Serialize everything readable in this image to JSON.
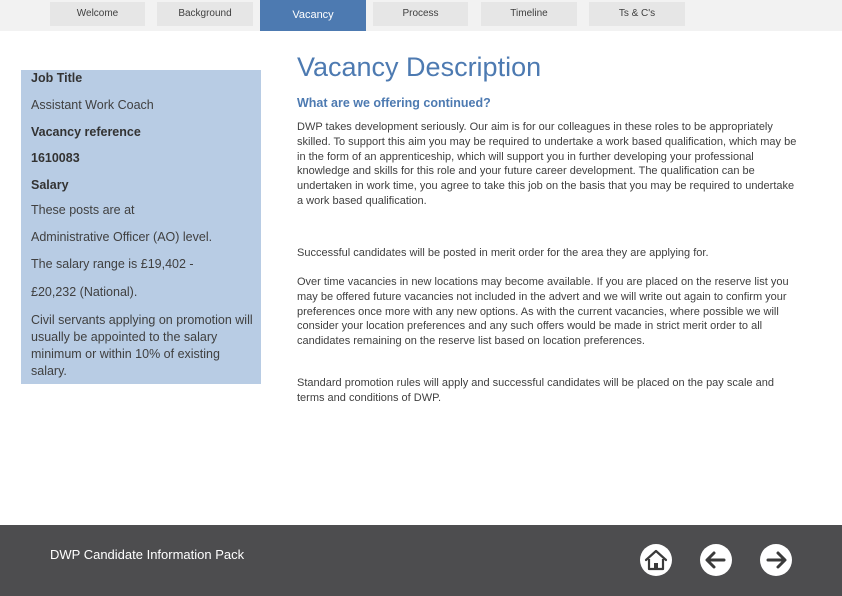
{
  "nav": {
    "tabs": [
      {
        "label": "Welcome"
      },
      {
        "label": "Background"
      },
      {
        "label": "Vacancy"
      },
      {
        "label": "Process"
      },
      {
        "label": "Timeline"
      },
      {
        "label": "Ts & C's"
      }
    ],
    "active": "Vacancy"
  },
  "sidebar": {
    "job_title_heading": "Job Title",
    "job_title": "Assistant Work Coach",
    "reference_heading": "Vacancy reference",
    "reference": "1610083",
    "salary_heading": "Salary",
    "salary_line1": "These posts are at",
    "salary_line2": "Administrative  Officer (AO) level.",
    "salary_line3": "The salary range is £19,402 -",
    "salary_line4": "£20,232 (National).",
    "salary_note": "Civil servants applying on promotion will usually be appointed to the salary minimum or within 10% of existing salary."
  },
  "main": {
    "title": "Vacancy Description",
    "subtitle": "What are we offering continued?",
    "paragraphs": [
      "DWP takes development seriously. Our aim is for our colleagues in these roles to be appropriately skilled. To support this aim you may be required to undertake a work based qualification, which may be in the form of an apprenticeship, which will support you in further developing your professional knowledge and skills for this role and your future career development. The qualification can be undertaken in work time, you agree to take this job on the basis that you may be required to undertake a work based qualification.",
      "Successful candidates will be posted in merit order for the area they are applying for.",
      "Over time vacancies in new locations may become available. If you are placed on the reserve list you may be offered future vacancies not included in the advert and we will write out again to confirm your preferences once more with any new options. As with the current vacancies, where possible we will consider your location preferences and any such offers would be made in strict merit order to all candidates remaining on the reserve list based on location preferences.",
      "Standard promotion rules will apply and successful candidates will be placed on the pay scale and terms and conditions of DWP."
    ]
  },
  "footer": {
    "title": "DWP Candidate Information Pack",
    "icons": [
      "home-icon",
      "back-arrow-icon",
      "forward-arrow-icon"
    ]
  },
  "colors": {
    "accent": "#4d7ab1",
    "panel": "#b8cce4",
    "footer": "#4d4d4f",
    "tab": "#e6e6e6"
  }
}
